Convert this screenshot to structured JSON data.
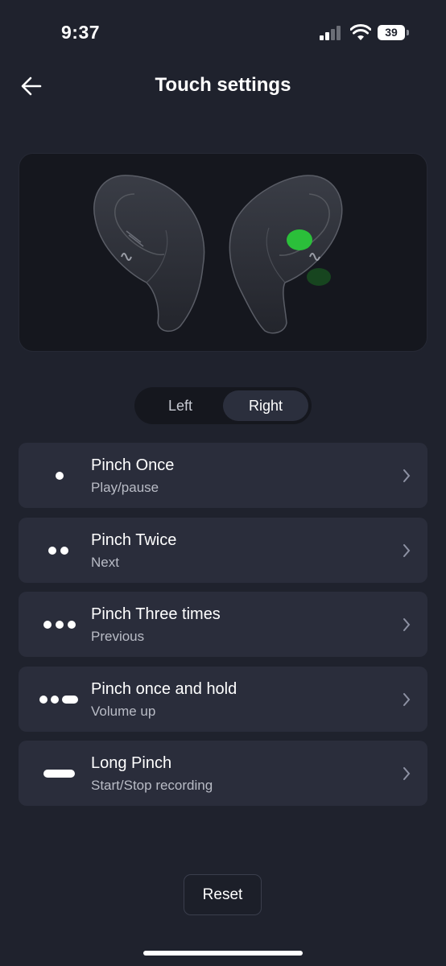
{
  "status_bar": {
    "time": "9:37",
    "battery": "39"
  },
  "header": {
    "title": "Touch settings"
  },
  "tabs": [
    {
      "label": "Left",
      "selected": false
    },
    {
      "label": "Right",
      "selected": true
    }
  ],
  "gestures": [
    {
      "title": "Pinch Once",
      "action": "Play/pause",
      "icon": "single-dot-icon"
    },
    {
      "title": "Pinch Twice",
      "action": "Next",
      "icon": "double-dot-icon"
    },
    {
      "title": "Pinch Three times",
      "action": "Previous",
      "icon": "triple-dot-icon"
    },
    {
      "title": "Pinch once and hold",
      "action": "Volume up",
      "icon": "dots-dash-icon"
    },
    {
      "title": "Long Pinch",
      "action": "Start/Stop recording",
      "icon": "long-dash-icon"
    }
  ],
  "reset_label": "Reset",
  "colors": {
    "background": "#1f222d",
    "row": "#2a2d3b",
    "accent_green": "#2bbf3a"
  }
}
